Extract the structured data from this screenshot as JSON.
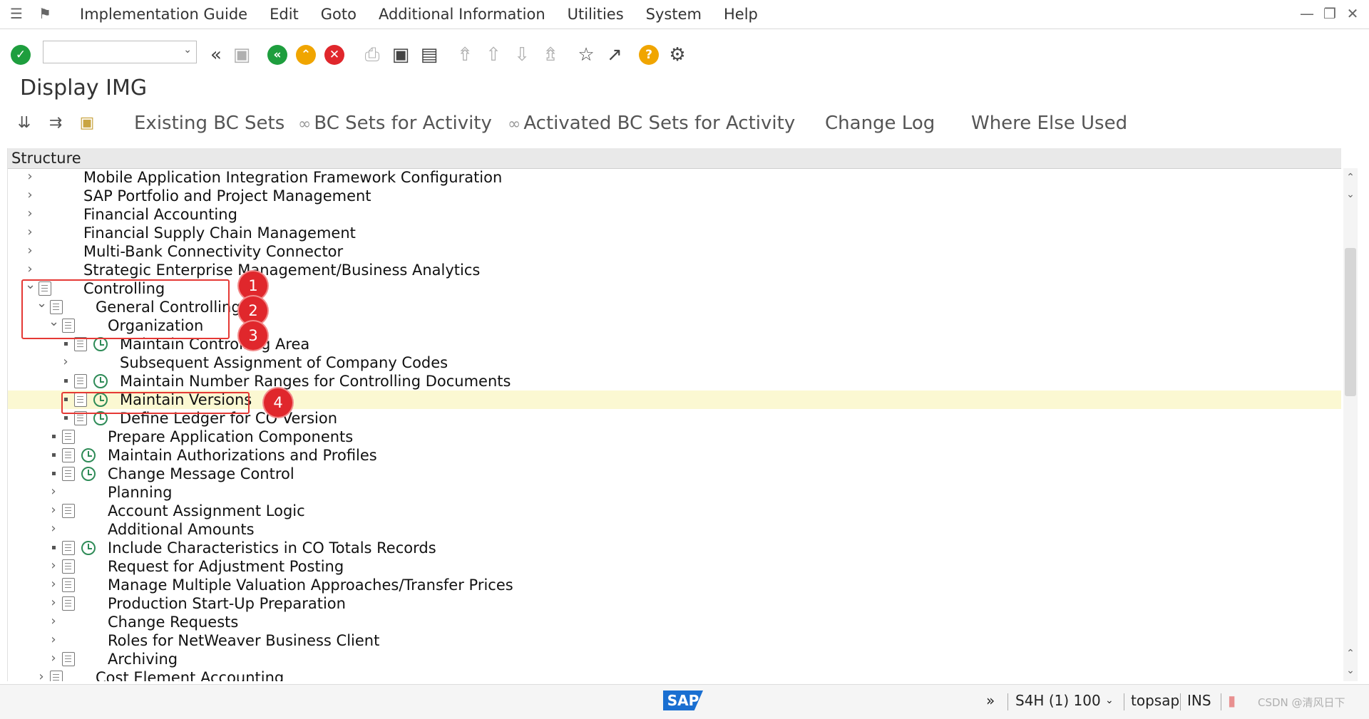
{
  "menu": {
    "items": [
      "Implementation Guide",
      "Edit",
      "Goto",
      "Additional Information",
      "Utilities",
      "System",
      "Help"
    ]
  },
  "toolbar": {
    "command_field_value": "",
    "icons": [
      "enter-icon",
      "back-icon",
      "save-icon",
      "green-back-icon",
      "exit-icon",
      "cancel-icon",
      "print-icon",
      "find-icon",
      "find-next-icon",
      "first-page-icon",
      "previous-page-icon",
      "next-page-icon",
      "last-page-icon",
      "create-session-icon",
      "shortcut-icon",
      "help-icon",
      "settings-icon"
    ]
  },
  "page": {
    "title": "Display IMG"
  },
  "app_toolbar": {
    "buttons": [
      "Existing BC Sets",
      "BC Sets for Activity",
      "Activated BC Sets for Activity",
      "Change Log",
      "Where Else Used"
    ]
  },
  "tree": {
    "header": "Structure",
    "rows": [
      {
        "label": "Mobile Application Integration Framework Configuration",
        "level": 0,
        "exp": "right",
        "doc": false,
        "clock": false
      },
      {
        "label": "SAP Portfolio and Project Management",
        "level": 0,
        "exp": "right",
        "doc": false,
        "clock": false
      },
      {
        "label": "Financial Accounting",
        "level": 0,
        "exp": "right",
        "doc": false,
        "clock": false
      },
      {
        "label": "Financial Supply Chain Management",
        "level": 0,
        "exp": "right",
        "doc": false,
        "clock": false
      },
      {
        "label": "Multi-Bank Connectivity Connector",
        "level": 0,
        "exp": "right",
        "doc": false,
        "clock": false
      },
      {
        "label": "Strategic Enterprise Management/Business Analytics",
        "level": 0,
        "exp": "right",
        "doc": false,
        "clock": false
      },
      {
        "label": "Controlling",
        "level": 0,
        "exp": "down",
        "doc": true,
        "clock": false
      },
      {
        "label": "General Controlling",
        "level": 1,
        "exp": "down",
        "doc": true,
        "clock": false
      },
      {
        "label": "Organization",
        "level": 2,
        "exp": "down",
        "doc": true,
        "clock": false
      },
      {
        "label": "Maintain Controlling Area",
        "level": 3,
        "exp": "bullet",
        "doc": true,
        "clock": true
      },
      {
        "label": "Subsequent Assignment of Company Codes",
        "level": 3,
        "exp": "right",
        "doc": false,
        "clock": false
      },
      {
        "label": "Maintain Number Ranges for Controlling Documents",
        "level": 3,
        "exp": "bullet",
        "doc": true,
        "clock": true
      },
      {
        "label": "Maintain Versions",
        "level": 3,
        "exp": "bullet",
        "doc": true,
        "clock": true,
        "highlight": true
      },
      {
        "label": "Define Ledger for CO Version",
        "level": 3,
        "exp": "bullet",
        "doc": true,
        "clock": true
      },
      {
        "label": "Prepare Application Components",
        "level": 2,
        "exp": "bullet",
        "doc": true,
        "clock": false
      },
      {
        "label": "Maintain Authorizations and Profiles",
        "level": 2,
        "exp": "bullet",
        "doc": true,
        "clock": true
      },
      {
        "label": "Change Message Control",
        "level": 2,
        "exp": "bullet",
        "doc": true,
        "clock": true
      },
      {
        "label": "Planning",
        "level": 2,
        "exp": "right",
        "doc": false,
        "clock": false
      },
      {
        "label": "Account Assignment Logic",
        "level": 2,
        "exp": "right",
        "doc": true,
        "clock": false
      },
      {
        "label": "Additional Amounts",
        "level": 2,
        "exp": "right",
        "doc": false,
        "clock": false
      },
      {
        "label": "Include Characteristics in CO Totals Records",
        "level": 2,
        "exp": "bullet",
        "doc": true,
        "clock": true
      },
      {
        "label": "Request for Adjustment Posting",
        "level": 2,
        "exp": "right",
        "doc": true,
        "clock": false
      },
      {
        "label": "Manage Multiple Valuation Approaches/Transfer Prices",
        "level": 2,
        "exp": "right",
        "doc": true,
        "clock": false
      },
      {
        "label": "Production Start-Up Preparation",
        "level": 2,
        "exp": "right",
        "doc": true,
        "clock": false
      },
      {
        "label": "Change Requests",
        "level": 2,
        "exp": "right",
        "doc": false,
        "clock": false
      },
      {
        "label": "Roles for NetWeaver Business Client",
        "level": 2,
        "exp": "right",
        "doc": false,
        "clock": false
      },
      {
        "label": "Archiving",
        "level": 2,
        "exp": "right",
        "doc": true,
        "clock": false
      },
      {
        "label": "Cost Element Accounting",
        "level": 1,
        "exp": "right",
        "doc": true,
        "clock": false
      }
    ]
  },
  "annotations": [
    "1",
    "2",
    "3",
    "4"
  ],
  "status": {
    "logo": "SAP",
    "system": "S4H (1) 100",
    "server": "topsap",
    "mode": "INS",
    "watermark": "CSDN @清风日下"
  }
}
